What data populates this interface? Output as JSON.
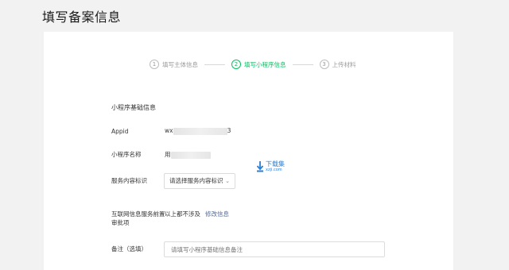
{
  "page": {
    "title": "填写备案信息"
  },
  "stepper": {
    "steps": [
      {
        "num": "1",
        "label": "填写主体信息"
      },
      {
        "num": "2",
        "label": "填写小程序信息"
      },
      {
        "num": "3",
        "label": "上传材料"
      }
    ],
    "active_index": 1
  },
  "form": {
    "section_title": "小程序基础信息",
    "appid": {
      "label": "Appid",
      "value_prefix": "wx",
      "value_suffix": "3"
    },
    "name": {
      "label": "小程序名称",
      "value_prefix": "用"
    },
    "service": {
      "label": "服务内容标识",
      "select_value": "请选择服务内容标识",
      "chevron_icon": "chevron-down-icon"
    },
    "approval": {
      "label": "互联网信息服务前置审批项",
      "value": "以上都不涉及",
      "link": "修改信息"
    },
    "remark": {
      "label": "备注（选填）",
      "placeholder": "请填写小程序基础信息备注"
    }
  },
  "watermark": {
    "text": "下载集",
    "sub": "xzji.com"
  },
  "colors": {
    "accent": "#07c160",
    "link": "#576b95",
    "background": "#f2f2f2"
  }
}
